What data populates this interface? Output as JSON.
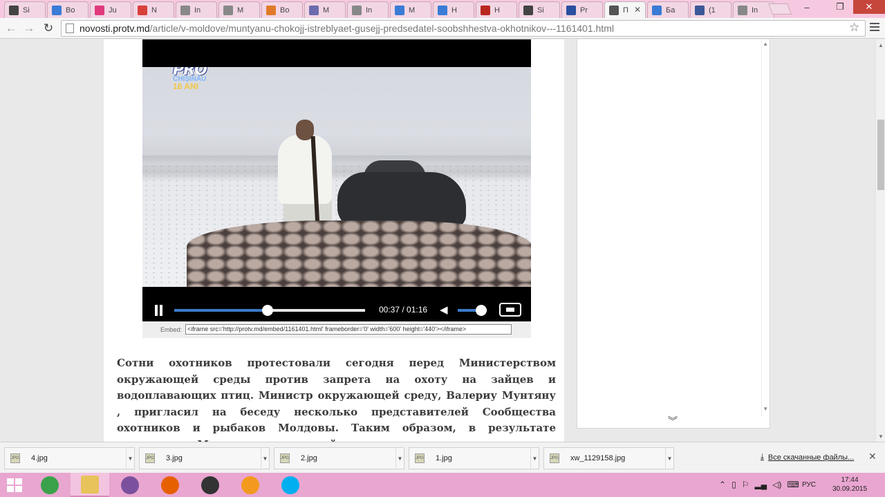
{
  "browser": {
    "tabs": [
      {
        "label": "Si",
        "icon": "flask-icon",
        "color": "#444"
      },
      {
        "label": "Bo",
        "icon": "blocks-icon",
        "color": "#3a7bd5"
      },
      {
        "label": "Ju",
        "icon": "magazine-icon",
        "color": "#e03a7c"
      },
      {
        "label": "N",
        "icon": "news-icon",
        "color": "#d9403a"
      },
      {
        "label": "In",
        "icon": "page-icon",
        "color": "#888"
      },
      {
        "label": "M",
        "icon": "page-icon",
        "color": "#888"
      },
      {
        "label": "Bo",
        "icon": "feather-icon",
        "color": "#e07a2a"
      },
      {
        "label": "M",
        "icon": "grid-icon",
        "color": "#6b6bb0"
      },
      {
        "label": "In",
        "icon": "page-icon",
        "color": "#888"
      },
      {
        "label": "M",
        "icon": "google-icon",
        "color": "#3a7bd5"
      },
      {
        "label": "H",
        "icon": "puzzle-icon",
        "color": "#3a7bd5"
      },
      {
        "label": "H",
        "icon": "flag-icon",
        "color": "#b8261f"
      },
      {
        "label": "Si",
        "icon": "flask-icon",
        "color": "#444"
      },
      {
        "label": "Pr",
        "icon": "protv-icon",
        "color": "#2a4fa0"
      },
      {
        "label": "П",
        "icon": "audio-icon",
        "color": "#555",
        "active": true
      },
      {
        "label": "Ба",
        "icon": "letter-b-icon",
        "color": "#3a7bd5"
      },
      {
        "label": "(1",
        "icon": "facebook-icon",
        "color": "#3b5998"
      },
      {
        "label": "In",
        "icon": "page-icon",
        "color": "#888"
      }
    ],
    "url_domain": "novosti.protv.md",
    "url_path": "/article/v-moldove/muntyanu-chokojj-istreblyaet-gusejj-predsedatel-soobshhestva-okhotnikov---1161401.html"
  },
  "video": {
    "logo_brand": "PRO",
    "logo_city": "CHIȘINĂU",
    "logo_years": "16 ANI",
    "time": "00:37 / 01:16",
    "progress": 0.49,
    "volume": 0.8,
    "embed_label": "Embed:",
    "embed_code": "<iframe src='http://protv.md/embed/1161401.html' frameborder='0' width='600' height='440'></iframe>"
  },
  "article": {
    "text": "Сотни охотников протестовали сегодня перед Министерством окружающей среды против запрета на охоту на зайцев и водоплавающих птиц. Министр окружающей среду, Валериу Мунтяну , пригласил на беседу несколько представителей Сообщества охотников и рыбаков Молдовы. Таким образом, в результате переговоров Министр окружающей среды показал видео, на"
  },
  "downloads": {
    "items": [
      "4.jpg",
      "3.jpg",
      "2.jpg",
      "1.jpg",
      "xw_1129158.jpg"
    ],
    "file_badge": "JPG",
    "show_all": "Все скачанные файлы..."
  },
  "taskbar": {
    "apps": [
      {
        "name": "chrome-icon",
        "color": "#3aa24a"
      },
      {
        "name": "file-explorer-icon",
        "color": "#e8c25a",
        "active": true
      },
      {
        "name": "viber-icon",
        "color": "#7b519d"
      },
      {
        "name": "firefox-icon",
        "color": "#e66000"
      },
      {
        "name": "camera-icon",
        "color": "#333333"
      },
      {
        "name": "messenger-icon",
        "color": "#f39a1e"
      },
      {
        "name": "skype-icon",
        "color": "#00aff0"
      }
    ],
    "language": "РУС",
    "time": "17:44",
    "date": "30.09.2015"
  }
}
